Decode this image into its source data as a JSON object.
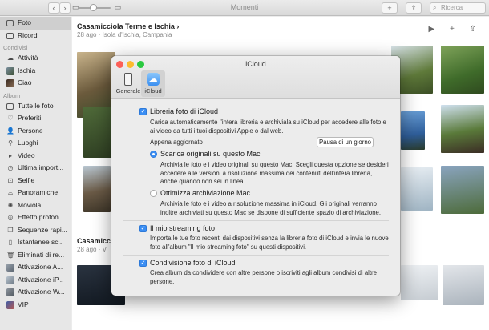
{
  "titlebar": {
    "title": "Momenti",
    "back_glyph": "‹",
    "forward_glyph": "›",
    "view_glyph": "▭",
    "add_glyph": "+",
    "share_glyph": "⇪",
    "search_placeholder": "Ricerca",
    "search_icon": "search-icon"
  },
  "sidebar": {
    "items_top": [
      {
        "label": "Foto",
        "icon": "photos-icon",
        "selected": true
      },
      {
        "label": "Ricordi",
        "icon": "memories-icon"
      }
    ],
    "section_shared": "Condivisi",
    "items_shared": [
      {
        "label": "Attività",
        "icon": "cloud-activity-icon"
      },
      {
        "label": "Ischia",
        "icon": "album-thumb-icon"
      },
      {
        "label": "Ciao",
        "icon": "album-thumb-icon"
      }
    ],
    "section_albums": "Album",
    "items_albums": [
      {
        "label": "Tutte le foto",
        "icon": "all-photos-icon"
      },
      {
        "label": "Preferiti",
        "icon": "heart-icon"
      },
      {
        "label": "Persone",
        "icon": "person-icon"
      },
      {
        "label": "Luoghi",
        "icon": "pin-icon"
      },
      {
        "label": "Video",
        "icon": "video-icon"
      },
      {
        "label": "Ultima import...",
        "icon": "clock-icon"
      },
      {
        "label": "Selfie",
        "icon": "selfie-icon"
      },
      {
        "label": "Panoramiche",
        "icon": "panorama-icon"
      },
      {
        "label": "Moviola",
        "icon": "slomo-icon"
      },
      {
        "label": "Effetto profon...",
        "icon": "depth-icon"
      },
      {
        "label": "Sequenze rapi...",
        "icon": "burst-icon"
      },
      {
        "label": "Istantanee sc...",
        "icon": "screenshot-icon"
      },
      {
        "label": "Eliminati di re...",
        "icon": "trash-icon"
      },
      {
        "label": "Attivazione A...",
        "icon": "album-thumb-icon"
      },
      {
        "label": "Attivazione iP...",
        "icon": "album-thumb-icon"
      },
      {
        "label": "Attivazione W...",
        "icon": "album-thumb-icon"
      },
      {
        "label": "VIP",
        "icon": "album-thumb-icon"
      }
    ]
  },
  "main": {
    "moment1_title": "Casamicciola Terme e Ischia",
    "moment1_chevron": "›",
    "moment1_sub": "28 ago  ·  Isola d'Ischia, Campania",
    "moment2_title": "Casamicciol",
    "moment2_sub": "28 ago  ·  Vi",
    "actions": "▶ + ⇪"
  },
  "dialog": {
    "title": "iCloud",
    "tabs": [
      {
        "label": "Generale",
        "icon": "switch-icon"
      },
      {
        "label": "iCloud",
        "icon": "icloud-icon",
        "active": true
      }
    ],
    "library_label": "Libreria foto di iCloud",
    "library_checked": true,
    "library_desc": "Carica automaticamente l'intera libreria e archiviala su iCloud per accedere alle foto e ai video da tutti i tuoi dispositivi Apple o dal web.",
    "updated_label": "Appena aggiornato",
    "pause_button": "Pausa di un giorno",
    "download_label": "Scarica originali su questo Mac",
    "download_desc": "Archivia le foto e i video originali su questo Mac. Scegli questa opzione se desideri accedere alle versioni a risoluzione massima dei contenuti dell'intera libreria, anche quando non sei in linea.",
    "optimize_label": "Ottimizza archiviazione Mac",
    "optimize_desc": "Archivia le foto e i video a risoluzione massima in iCloud. Gli originali verranno inoltre archiviati su questo Mac se dispone di sufficiente spazio di archiviazione.",
    "streaming_label": "Il mio streaming foto",
    "streaming_checked": true,
    "streaming_desc": "Importa le tue foto recenti dai dispositivi senza la libreria foto di iCloud e invia le nuove foto all'album \"Il mio streaming foto\" su questi dispositivi.",
    "sharing_label": "Condivisione foto di iCloud",
    "sharing_checked": true,
    "sharing_desc": "Crea album da condividere con altre persone o iscriviti agli album condivisi di altre persone.",
    "checkmark": "✓"
  },
  "colors": {
    "accent": "#3b8ef3",
    "close": "#fc5f57",
    "minimize": "#fdbb2f",
    "zoom": "#2ac940"
  }
}
